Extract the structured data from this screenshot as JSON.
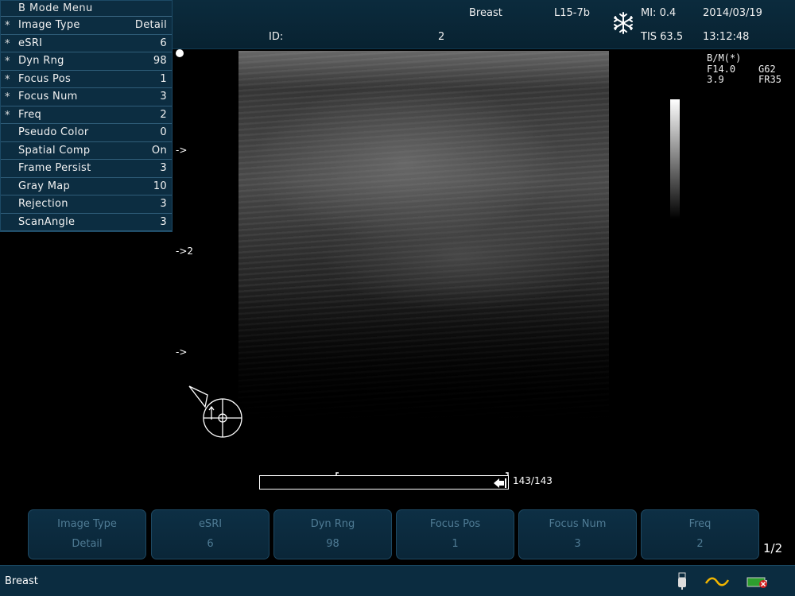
{
  "header": {
    "exam": "Breast",
    "probe": "L15-7b",
    "mi": "MI: 0.4",
    "tis": "TIS 63.5",
    "date": "2014/03/19",
    "time": "13:12:48",
    "id_label": "ID:",
    "id_value": "2",
    "freeze_icon": "snowflake-icon"
  },
  "menu": {
    "title": "B Mode Menu",
    "items": [
      {
        "star": "*",
        "label": "Image Type",
        "value": "Detail"
      },
      {
        "star": "*",
        "label": "eSRI",
        "value": "6"
      },
      {
        "star": "*",
        "label": "Dyn Rng",
        "value": "98"
      },
      {
        "star": "*",
        "label": "Focus Pos",
        "value": "1"
      },
      {
        "star": "*",
        "label": "Focus Num",
        "value": "3"
      },
      {
        "star": "*",
        "label": "Freq",
        "value": "2"
      },
      {
        "star": "",
        "label": "Pseudo Color",
        "value": "0"
      },
      {
        "star": "",
        "label": "Spatial Comp",
        "value": "On"
      },
      {
        "star": "",
        "label": "Frame Persist",
        "value": "3"
      },
      {
        "star": "",
        "label": "Gray Map",
        "value": "10"
      },
      {
        "star": "",
        "label": "Rejection",
        "value": "3"
      },
      {
        "star": "",
        "label": "ScanAngle",
        "value": "3"
      }
    ]
  },
  "focus_markers": [
    "->",
    "->2",
    "->"
  ],
  "params": {
    "line1": "B/M(*)",
    "line2": "F14.0    G62",
    "line3": "3.9      FR35"
  },
  "cine": {
    "label": "143/143",
    "progress": 1.0
  },
  "softkeys": [
    {
      "label": "Image Type",
      "value": "Detail"
    },
    {
      "label": "eSRI",
      "value": "6"
    },
    {
      "label": "Dyn Rng",
      "value": "98"
    },
    {
      "label": "Focus Pos",
      "value": "1"
    },
    {
      "label": "Focus Num",
      "value": "3"
    },
    {
      "label": "Freq",
      "value": "2"
    }
  ],
  "page_indicator": "1/2",
  "status": {
    "text": "Breast",
    "icons": [
      "usb-icon",
      "trackball-icon",
      "battery-icon"
    ]
  }
}
